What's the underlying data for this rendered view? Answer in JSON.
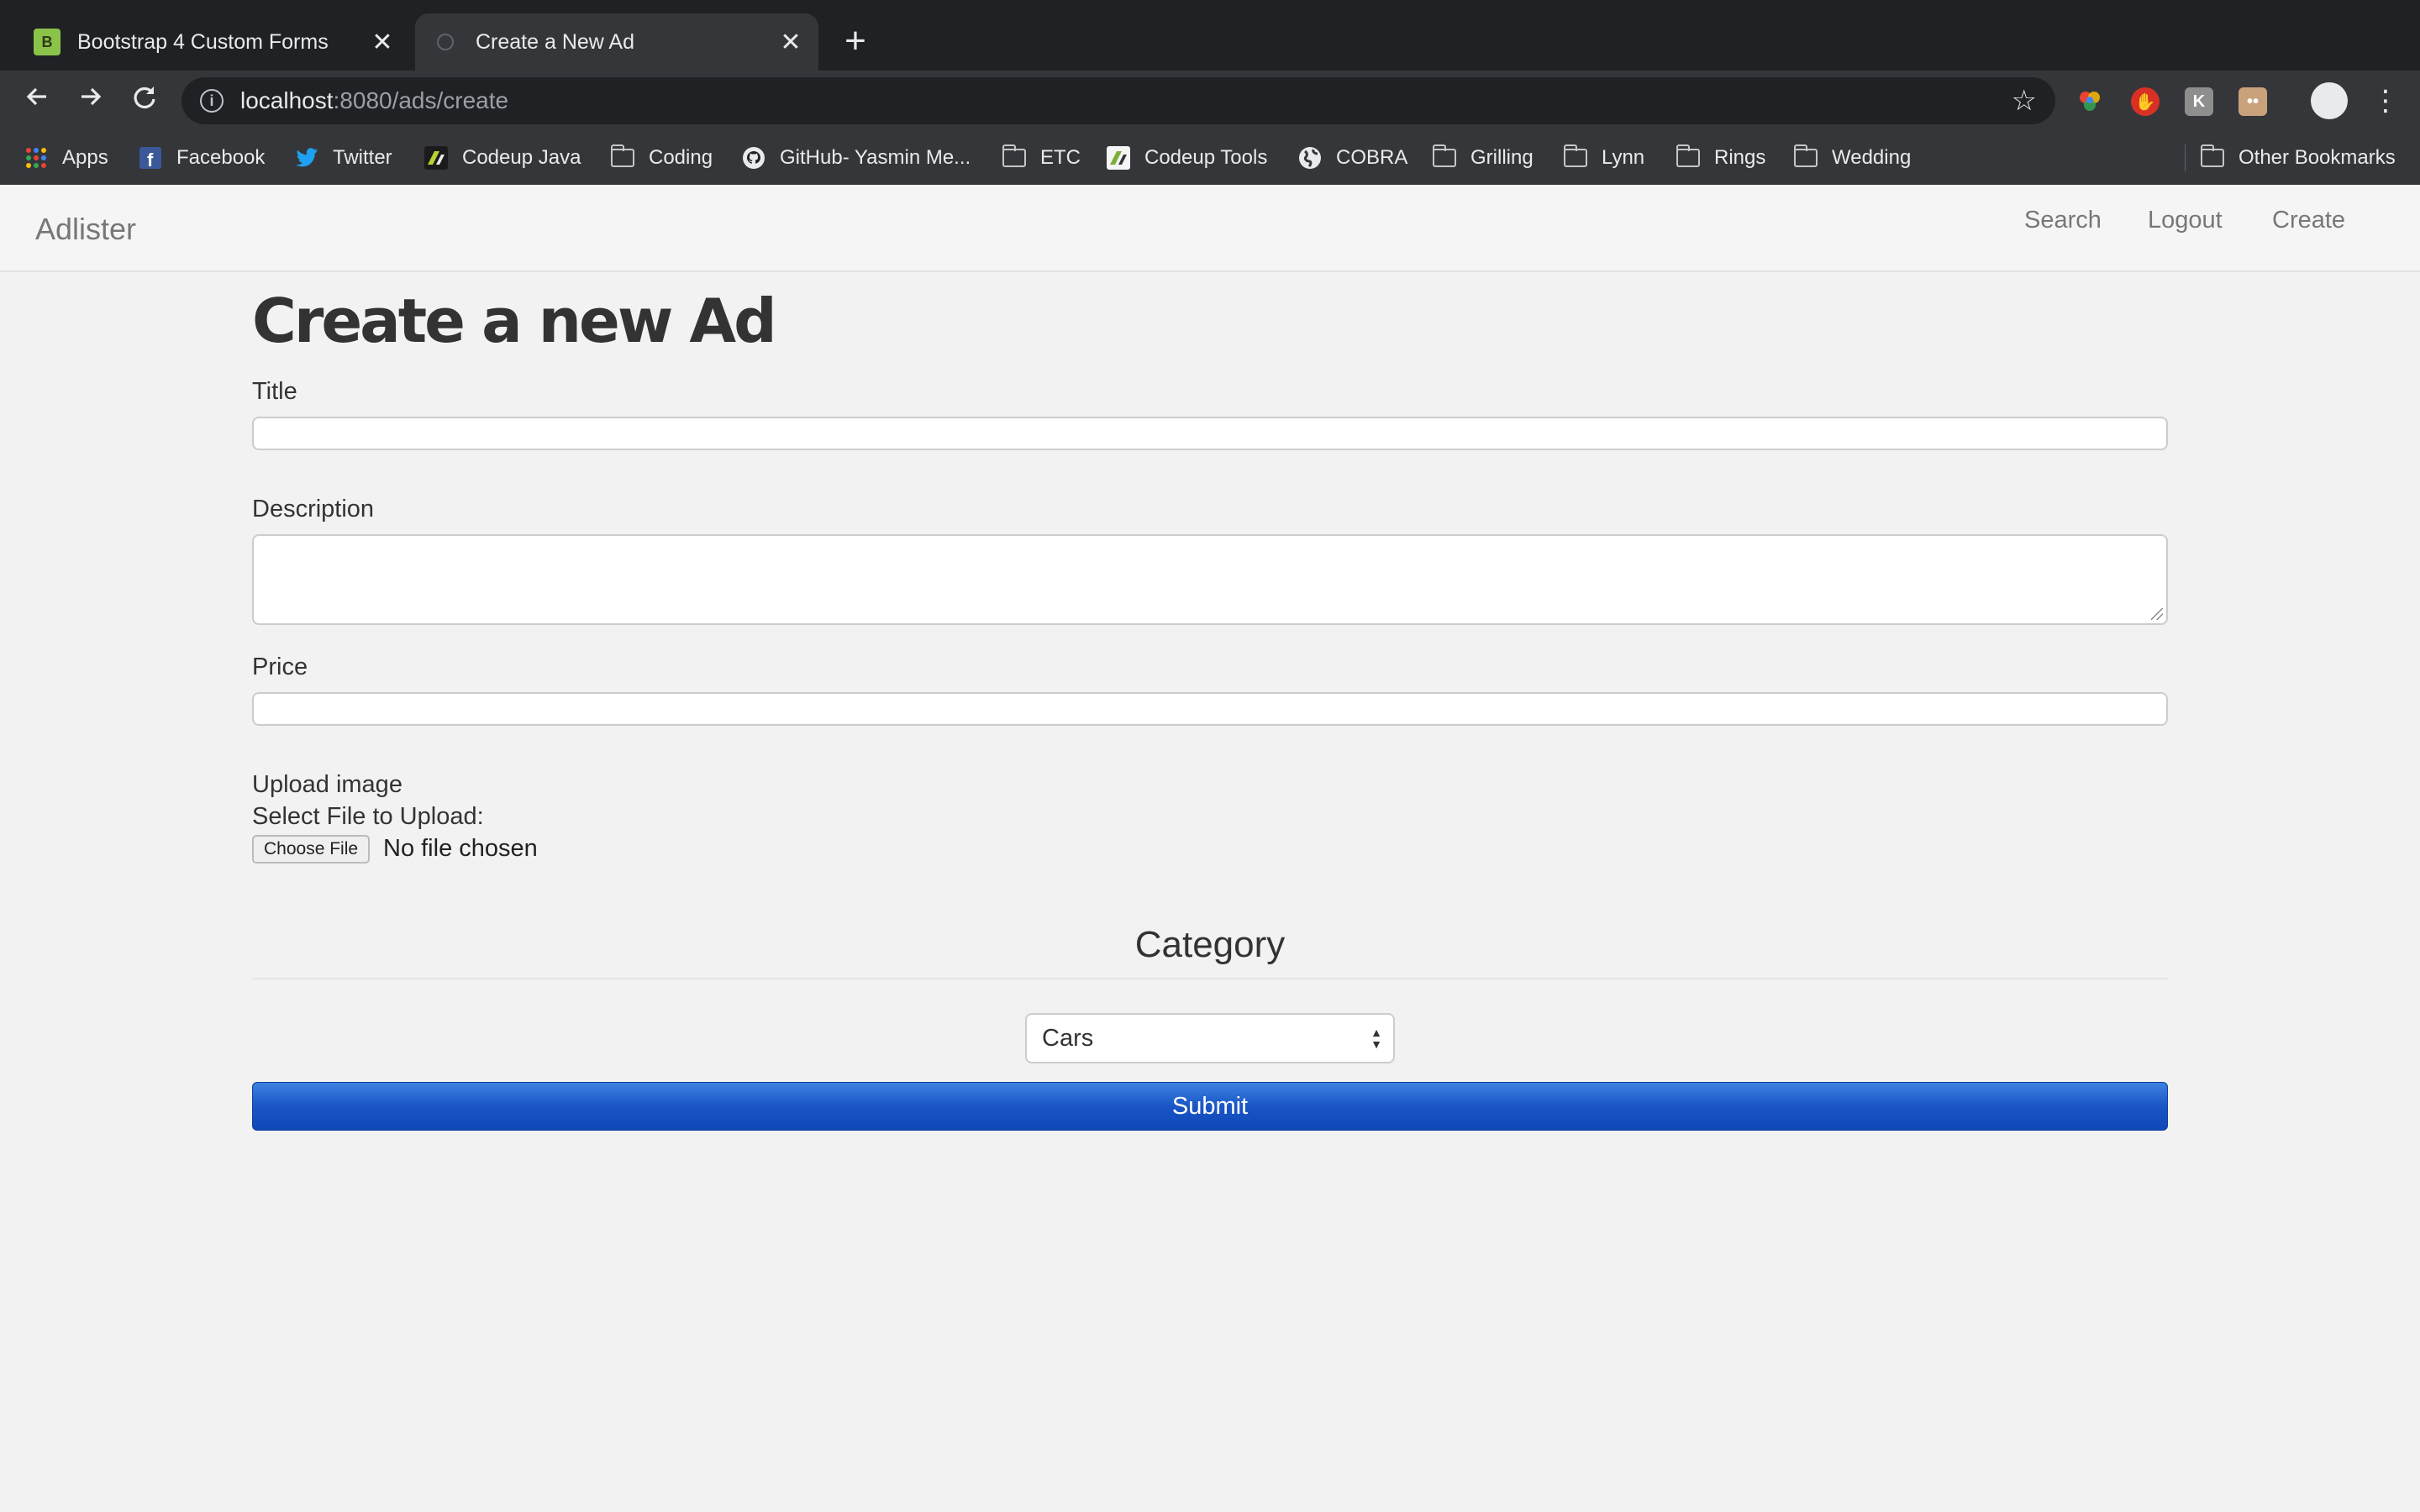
{
  "browser": {
    "tabs": [
      {
        "title": "Bootstrap 4 Custom Forms",
        "favicon": "b4-icon",
        "active": false
      },
      {
        "title": "Create a New Ad",
        "favicon": "page-icon",
        "active": true
      }
    ],
    "close_glyph": "✕",
    "new_tab_glyph": "+",
    "url_host": "localhost",
    "url_path": ":8080/ads/create",
    "bookmarks": [
      {
        "label": "Apps",
        "icon": "apps-grid-icon"
      },
      {
        "label": "Facebook",
        "icon": "facebook-icon"
      },
      {
        "label": "Twitter",
        "icon": "twitter-icon"
      },
      {
        "label": "Codeup Java",
        "icon": "codeup-icon"
      },
      {
        "label": "Coding",
        "icon": "folder-icon"
      },
      {
        "label": "GitHub- Yasmin Me...",
        "icon": "github-icon"
      },
      {
        "label": "ETC",
        "icon": "folder-icon"
      },
      {
        "label": "Codeup Tools",
        "icon": "codeup-icon"
      },
      {
        "label": "COBRA",
        "icon": "globe-icon"
      },
      {
        "label": "Grilling",
        "icon": "folder-icon"
      },
      {
        "label": "Lynn",
        "icon": "folder-icon"
      },
      {
        "label": "Rings",
        "icon": "folder-icon"
      },
      {
        "label": "Wedding",
        "icon": "folder-icon"
      },
      {
        "label": "Other Bookmarks",
        "icon": "folder-icon"
      }
    ]
  },
  "navbar": {
    "brand": "Adlister",
    "links": [
      "Search",
      "Logout",
      "Create"
    ]
  },
  "form": {
    "heading": "Create a new Ad",
    "title_label": "Title",
    "title_value": "",
    "description_label": "Description",
    "description_value": "",
    "price_label": "Price",
    "price_value": "",
    "upload_label": "Upload image",
    "upload_prompt": "Select File to Upload:",
    "choose_file_label": "Choose File",
    "file_status": "No file chosen",
    "category_heading": "Category",
    "category_selected": "Cars",
    "submit_label": "Submit"
  },
  "colors": {
    "chrome_dark": "#202124",
    "chrome_toolbar": "#35363a",
    "submit_blue": "#1a56c6",
    "page_bg": "#f2f2f2"
  }
}
